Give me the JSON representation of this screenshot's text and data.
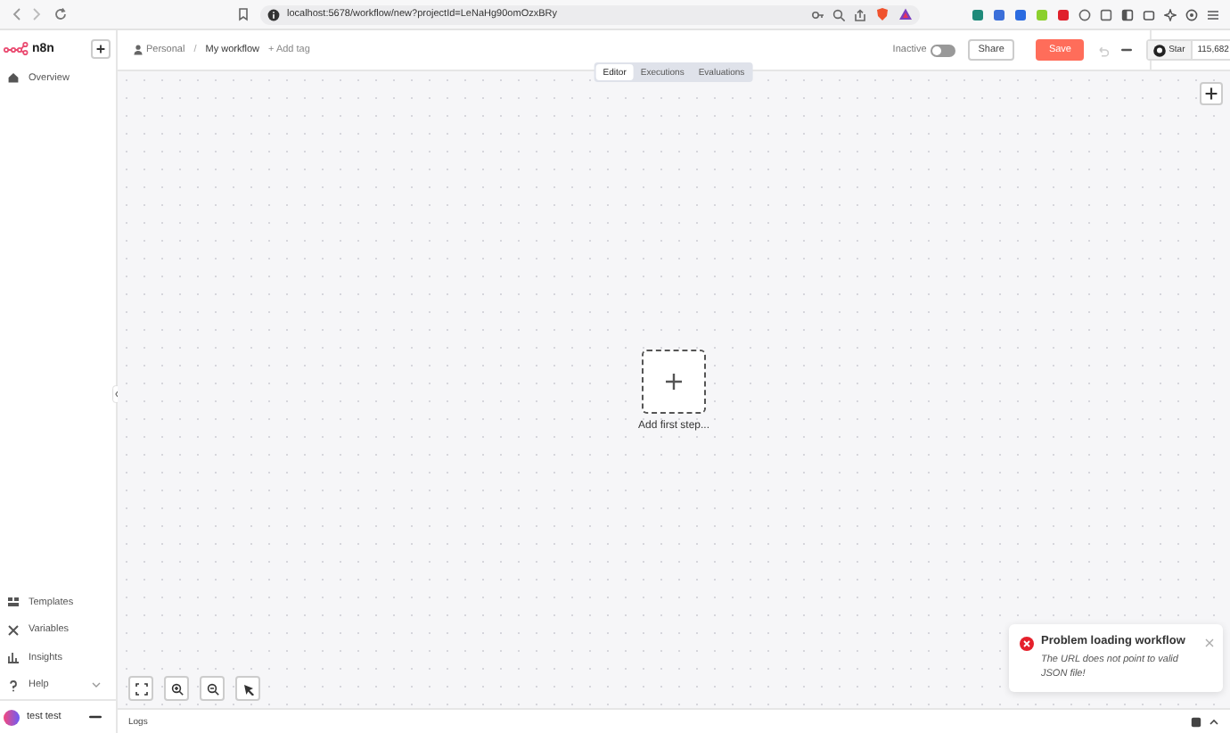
{
  "browser": {
    "url": "localhost:5678/workflow/new?projectId=LeNaHg90omOzxBRy"
  },
  "sidebar": {
    "logo": "n8n",
    "items": [
      {
        "label": "Overview",
        "kind": "home"
      }
    ],
    "bottom_items": [
      {
        "label": "Templates",
        "kind": "templates"
      },
      {
        "label": "Variables",
        "kind": "variables"
      },
      {
        "label": "Insights",
        "kind": "insights"
      },
      {
        "label": "Help",
        "kind": "help",
        "expandable": true
      }
    ],
    "user": {
      "name": "test test"
    }
  },
  "header": {
    "project": "Personal",
    "separator": "/",
    "workflow": "My workflow",
    "add_tag": "+ Add tag",
    "status": {
      "label": "Inactive",
      "on": false
    },
    "share": "Share",
    "save": "Save",
    "github": {
      "label": "Star",
      "count": "115,682"
    }
  },
  "tabs": [
    {
      "label": "Editor",
      "selected": true
    },
    {
      "label": "Executions",
      "selected": false
    },
    {
      "label": "Evaluations",
      "selected": false
    }
  ],
  "canvas": {
    "add_label": "Add first step..."
  },
  "toast": {
    "title": "Problem loading workflow",
    "message": "The URL does not point to valid JSON file!"
  },
  "logs": {
    "label": "Logs"
  }
}
